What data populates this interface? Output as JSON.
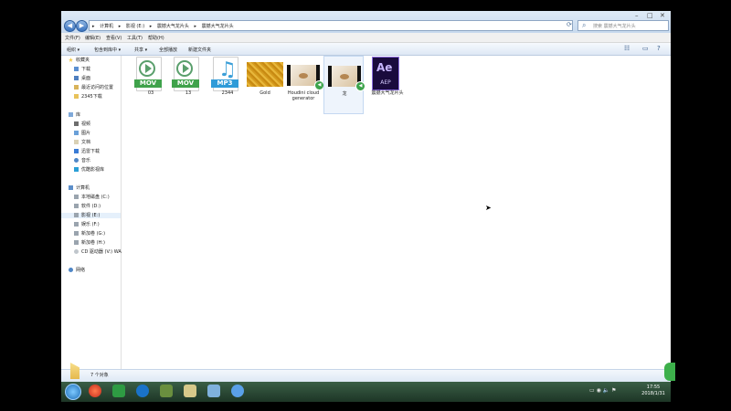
{
  "address": {
    "crumbs": [
      "计算机",
      "影视 (E:)",
      "震撼大气龙片头",
      "震撼大气龙片头"
    ],
    "search_placeholder": "搜索 震撼大气龙片头"
  },
  "menu": [
    "文件(F)",
    "编辑(E)",
    "查看(V)",
    "工具(T)",
    "帮助(H)"
  ],
  "toolbar": {
    "organize": "组织 ▾",
    "include_library": "包含到库中 ▾",
    "share": "共享 ▾",
    "play_all": "全部播放",
    "new_folder": "新建文件夹"
  },
  "nav": {
    "favorites": "收藏夹",
    "fav_items": [
      "下载",
      "桌面",
      "最近访问的位置",
      "2345下载"
    ],
    "libraries": "库",
    "lib_items": [
      "视频",
      "图片",
      "文档",
      "迅雷下载",
      "音乐",
      "优酷影视库"
    ],
    "computer": "计算机",
    "drives": [
      "本地磁盘 (C:)",
      "软件 (D:)",
      "影视 (E:)",
      "娱乐 (F:)",
      "新加卷 (G:)",
      "新加卷 (H:)",
      "CD 驱动器 (V:) WA"
    ],
    "network": "网络"
  },
  "files": [
    {
      "name": "03",
      "type": "MOV"
    },
    {
      "name": "13",
      "type": "MOV"
    },
    {
      "name": "2344",
      "type": "MP3"
    },
    {
      "name": "Gold",
      "type": "image"
    },
    {
      "name": "Houdini cloud generator",
      "type": "video"
    },
    {
      "name": "龙",
      "type": "video"
    },
    {
      "name": "震撼大气龙片头",
      "type": "AEP"
    }
  ],
  "colors": {
    "mov": "#3fa24b",
    "mp3": "#2f9bd8",
    "ae": "#1a0b3d"
  },
  "status": {
    "count": "7 个对象"
  },
  "clock": {
    "time": "17:55",
    "date": "2018/1/31"
  }
}
